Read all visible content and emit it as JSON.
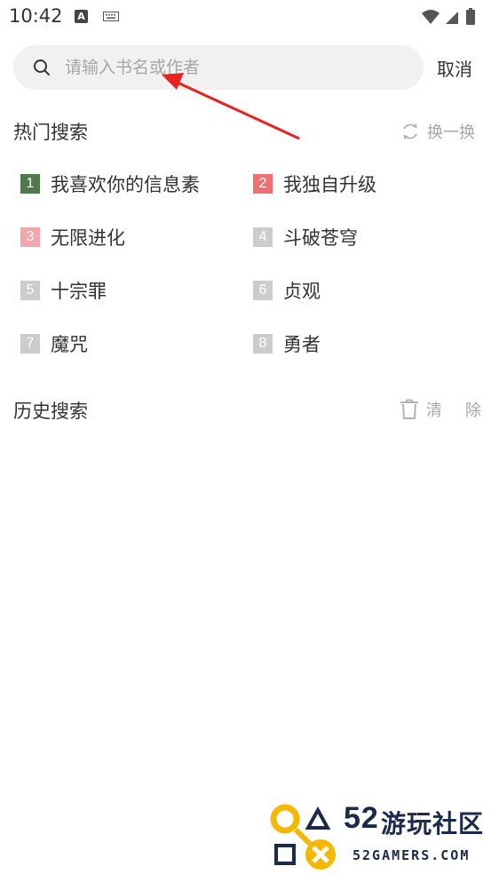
{
  "status_bar": {
    "time": "10:42",
    "notif_letter": "A"
  },
  "search": {
    "placeholder": "请输入书名或作者",
    "value": "",
    "cancel_label": "取消"
  },
  "hot": {
    "title": "热门搜索",
    "refresh_label": "换一换",
    "items": [
      {
        "rank": "1",
        "name": "我喜欢你的信息素",
        "color": "#4e7a4a"
      },
      {
        "rank": "2",
        "name": "我独自升级",
        "color": "#ef6f73"
      },
      {
        "rank": "3",
        "name": "无限进化",
        "color": "#f3a5aa"
      },
      {
        "rank": "4",
        "name": "斗破苍穹",
        "color": "#cccccc"
      },
      {
        "rank": "5",
        "name": "十宗罪",
        "color": "#cccccc"
      },
      {
        "rank": "6",
        "name": "贞观",
        "color": "#cccccc"
      },
      {
        "rank": "7",
        "name": "魔咒",
        "color": "#cccccc"
      },
      {
        "rank": "8",
        "name": "勇者",
        "color": "#cccccc"
      }
    ]
  },
  "history": {
    "title": "历史搜索",
    "clear_label": "清　除"
  },
  "watermark": {
    "brand_num": "52",
    "brand_cn": "游玩社区",
    "brand_en": "52GAMERS.COM"
  }
}
